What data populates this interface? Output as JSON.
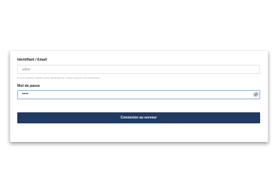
{
  "login": {
    "identifier_label": "Identifiant / Email",
    "identifier_placeholder": "admin",
    "identifier_hint": "Si vous possédez multiples codes identification(s), veuillez essayer le format précédent.",
    "password_label": "Mot de passe",
    "password_value": "••••",
    "eye_icon": "eye-slash-icon",
    "submit_label": "Connexion au serveur"
  },
  "colors": {
    "button_bg": "#1f3a63",
    "focus_border": "#8fb3d6"
  }
}
